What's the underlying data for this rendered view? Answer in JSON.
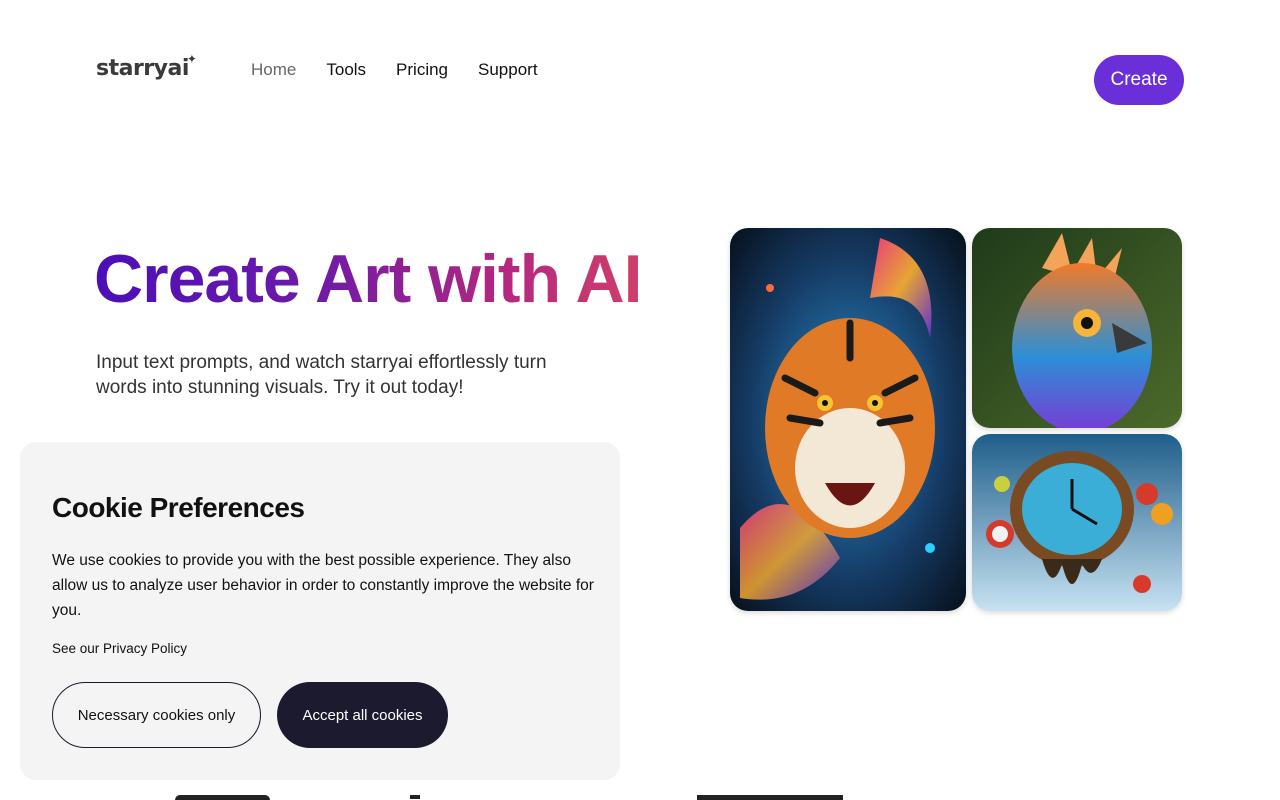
{
  "header": {
    "logo": "starryai",
    "nav": [
      "Home",
      "Tools",
      "Pricing",
      "Support"
    ],
    "create_label": "Create"
  },
  "hero": {
    "title": "Create Art with AI",
    "subtitle": "Input text prompts, and watch starryai effortlessly turn words into stunning visuals. Try it out today!"
  },
  "gallery": {
    "images": [
      "tiger-art",
      "bird-art",
      "melting-clock-art"
    ]
  },
  "cookie": {
    "title": "Cookie Preferences",
    "body": "We use cookies to provide you with the best possible experience. They also allow us to analyze user behavior in order to constantly improve the website for you.",
    "policy_link": "See our Privacy Policy",
    "necessary_label": "Necessary cookies only",
    "accept_label": "Accept all cookies"
  },
  "colors": {
    "accent": "#6a2fd9",
    "dark_button": "#1c1a2e",
    "cookie_bg": "#f4f4f5"
  }
}
